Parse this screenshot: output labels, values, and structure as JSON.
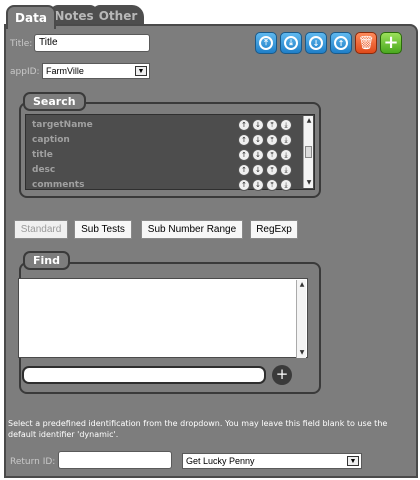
{
  "tabs": [
    {
      "label": "Data",
      "active": true
    },
    {
      "label": "Notes",
      "active": false
    },
    {
      "label": "Other",
      "active": false
    }
  ],
  "form": {
    "title_label": "Title:",
    "title_value": "Title",
    "appid_label": "appID:",
    "appid_value": "FarmVille"
  },
  "toolbar": {
    "icons": [
      "collapse-icon",
      "expand-icon",
      "move-down-icon",
      "move-up-icon",
      "trash-icon",
      "add-icon"
    ]
  },
  "search": {
    "title": "Search",
    "rows": [
      {
        "name": "targetName"
      },
      {
        "name": "caption"
      },
      {
        "name": "title"
      },
      {
        "name": "desc"
      },
      {
        "name": "comments"
      }
    ]
  },
  "modes": {
    "standard": "Standard",
    "sub_tests": "Sub Tests",
    "sub_number_range": "Sub Number Range",
    "regexp": "RegExp"
  },
  "find": {
    "title": "Find"
  },
  "help_text": "Select a predefined identification from the dropdown. You may leave this field blank to use the default identifier 'dynamic'.",
  "return_id": {
    "label": "Return ID:",
    "value": "",
    "dropdown_value": "Get Lucky Penny"
  },
  "colors": {
    "panel": "#7d7d7d",
    "accent_blue": "#1f7fc8",
    "trash_red": "#e04a1a",
    "add_green": "#4aa81f"
  }
}
